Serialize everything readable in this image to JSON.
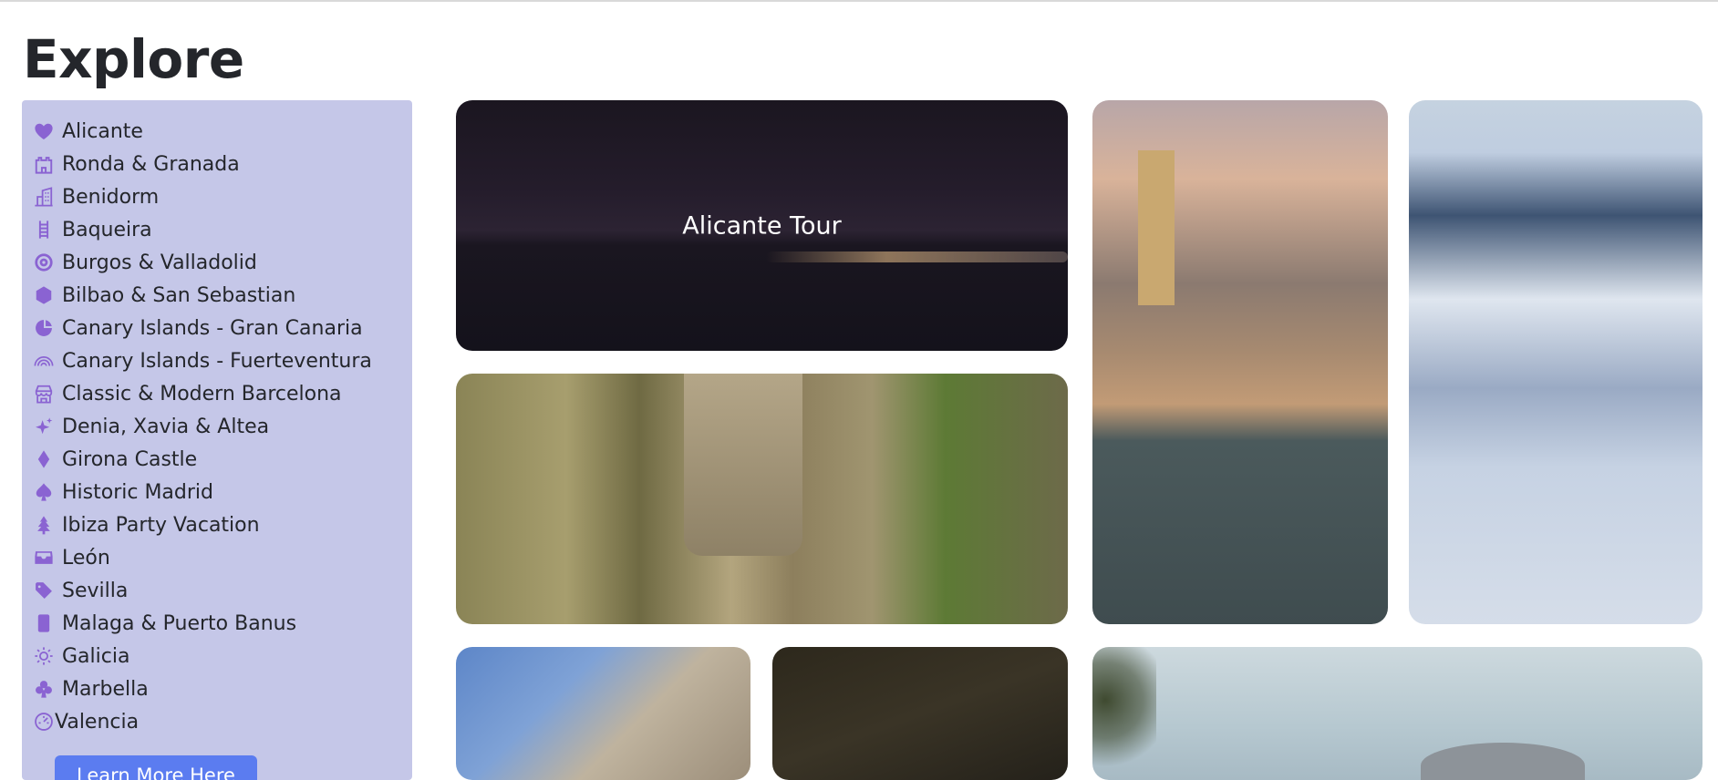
{
  "page": {
    "title": "Explore"
  },
  "sidebar": {
    "items": [
      {
        "label": "Alicante",
        "icon": "heart-icon"
      },
      {
        "label": "Ronda & Granada",
        "icon": "castle-icon"
      },
      {
        "label": "Benidorm",
        "icon": "buildings-icon"
      },
      {
        "label": "Baqueira",
        "icon": "ladder-icon"
      },
      {
        "label": "Burgos & Valladolid",
        "icon": "life-ring-icon"
      },
      {
        "label": "Bilbao & San Sebastian",
        "icon": "hexagon-icon"
      },
      {
        "label": "Canary Islands - Gran Canaria",
        "icon": "pie-chart-icon"
      },
      {
        "label": "Canary Islands - Fuerteventura",
        "icon": "rainbow-icon"
      },
      {
        "label": "Classic & Modern Barcelona",
        "icon": "shop-icon"
      },
      {
        "label": "Denia, Xavia & Altea",
        "icon": "stars-icon"
      },
      {
        "label": "Girona Castle",
        "icon": "diamond-icon"
      },
      {
        "label": "Historic Madrid",
        "icon": "spade-icon"
      },
      {
        "label": "Ibiza Party Vacation",
        "icon": "tree-icon"
      },
      {
        "label": "León",
        "icon": "inbox-icon"
      },
      {
        "label": "Sevilla",
        "icon": "tag-icon"
      },
      {
        "label": "Malaga & Puerto Banus",
        "icon": "phone-icon"
      },
      {
        "label": "Galicia",
        "icon": "sun-icon"
      },
      {
        "label": "Marbella",
        "icon": "club-icon"
      },
      {
        "label": "Valencia",
        "icon": "speedometer-icon"
      }
    ],
    "button_label": "Learn More Here"
  },
  "gallery": {
    "alicante_label": "Alicante Tour"
  },
  "colors": {
    "sidebar_bg": "#c5c7e8",
    "icon_color": "#8a63d2",
    "button_bg": "#5b7cf0"
  }
}
